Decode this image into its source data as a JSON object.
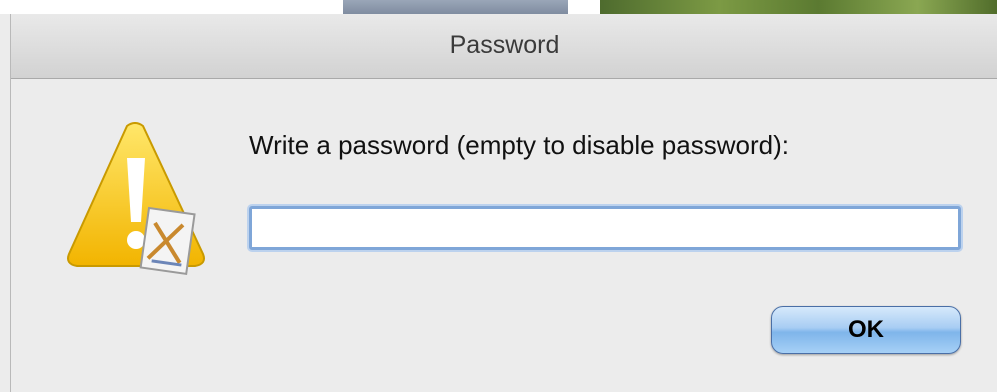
{
  "dialog": {
    "title": "Password",
    "message": "Write a password (empty to disable password):",
    "password_value": "",
    "ok_label": "OK",
    "icon": "warning-triangle-with-app-icon",
    "accent_color": "#7fb5ea"
  }
}
